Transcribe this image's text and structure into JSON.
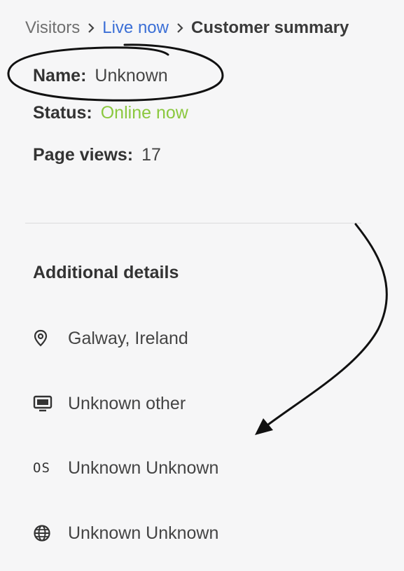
{
  "breadcrumb": {
    "items": [
      {
        "label": "Visitors"
      },
      {
        "label": "Live now"
      },
      {
        "label": "Customer summary"
      }
    ]
  },
  "summary": {
    "name_label": "Name:",
    "name_value": "Unknown",
    "status_label": "Status:",
    "status_value": "Online now",
    "page_views_label": "Page views:",
    "page_views_value": "17"
  },
  "details": {
    "title": "Additional details",
    "items": [
      {
        "icon": "location-pin-icon",
        "value": "Galway, Ireland"
      },
      {
        "icon": "monitor-icon",
        "value": "Unknown other"
      },
      {
        "icon": "os-icon",
        "icon_text": "OS",
        "value": "Unknown Unknown"
      },
      {
        "icon": "globe-icon",
        "value": "Unknown Unknown"
      }
    ]
  },
  "colors": {
    "link": "#3b6fd6",
    "online": "#8bc83f",
    "background": "#f6f6f7"
  }
}
